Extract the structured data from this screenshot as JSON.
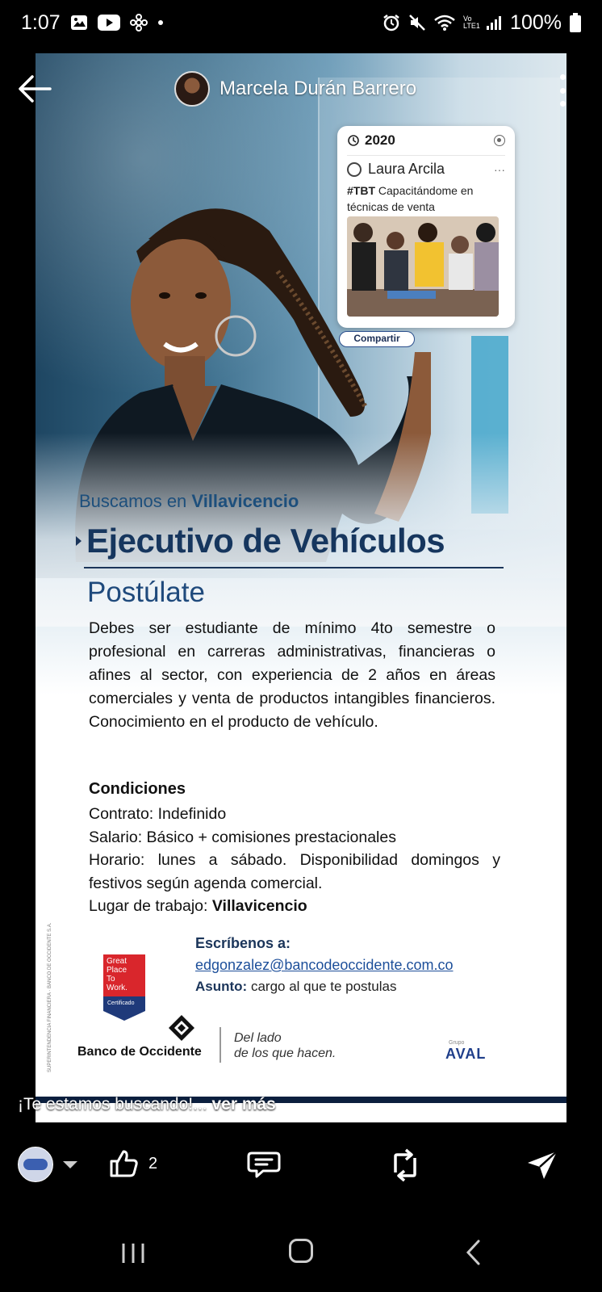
{
  "status_bar": {
    "time": "1:07",
    "battery": "100%",
    "network": "Vo LTE1"
  },
  "header": {
    "author_name": "Marcela Durán Barrero"
  },
  "post_image": {
    "tbt_card": {
      "year": "2020",
      "user": "Laura Arcila",
      "hashtag": "#TBT",
      "text": "Capacitándome en técnicas de venta",
      "share_label": "Compartir"
    },
    "subtitle_prefix": "Buscamos en",
    "subtitle_city": "Villavicencio",
    "title": "Ejecutivo de Vehículos",
    "apply_heading": "Postúlate",
    "description": "Debes ser estudiante de mínimo 4to semestre o profesional en carreras administrativas, financieras o afines al sector, con experiencia de 2 años en áreas comerciales y venta de productos intangibles financieros. Conocimiento en el producto de vehículo.",
    "conditions_heading": "Condiciones",
    "conditions": {
      "contract": "Contrato: Indefinido",
      "salary": "Salario: Básico + comisiones prestacionales",
      "schedule": "Horario: lunes a sábado. Disponibilidad domingos y festivos según agenda comercial.",
      "workplace_label": "Lugar de trabajo:",
      "workplace_value": "Villavicencio"
    },
    "contact": {
      "heading": "Escríbenos a:",
      "email": "edgonzalez@bancodeoccidente.com.co",
      "subject_label": "Asunto:",
      "subject_value": "cargo al que te postulas"
    },
    "badge": {
      "line1": "Great",
      "line2": "Place",
      "line3": "To",
      "line4": "Work.",
      "cert": "Certificado"
    },
    "bank_name": "Banco de Occidente",
    "slogan_line1": "Del lado",
    "slogan_line2": "de los que hacen.",
    "group_small": "Grupo",
    "group_name": "AVAL",
    "legal_text": "SUPERINTENDENCIA FINANCIERA · BANCO DE OCCIDENTE S.A."
  },
  "caption": {
    "text": "¡Te estamos buscando!...",
    "more": "ver más"
  },
  "actions": {
    "like_count": "2"
  },
  "colors": {
    "brand_navy": "#16365e",
    "brand_blue": "#1d4f7c",
    "link_blue": "#1d4f9a",
    "badge_red": "#d9262c",
    "aval_blue": "#1f3e8a"
  }
}
